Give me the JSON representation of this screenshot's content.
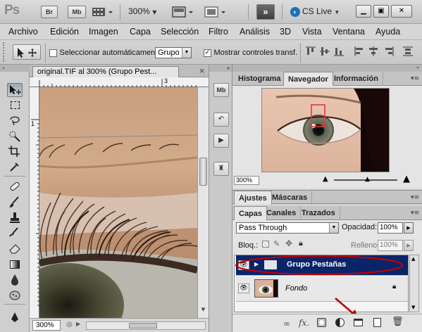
{
  "appbar": {
    "logo": "Ps",
    "btn_br": "Br",
    "btn_mb": "Mb",
    "zoom": "300%",
    "cslive": "CS Live",
    "expand_label": "»"
  },
  "menu": [
    "Archivo",
    "Edición",
    "Imagen",
    "Capa",
    "Selección",
    "Filtro",
    "Análisis",
    "3D",
    "Vista",
    "Ventana",
    "Ayuda"
  ],
  "options": {
    "auto_select_label": "Seleccionar automáticamente:",
    "auto_select_value": "Grupo",
    "show_transform_label": "Mostrar controles transf."
  },
  "document": {
    "tab_title": "original.TIF al 300% (Grupo Pest...",
    "close": "×",
    "ruler_top_tick": "3",
    "ruler_left_tick": "1",
    "zoom_status": "300%"
  },
  "navigator": {
    "tabs": [
      "Histograma",
      "Navegador",
      "Información"
    ],
    "active_tab": "Navegador",
    "zoom": "300%"
  },
  "adjust": {
    "tabs": [
      "Ajustes",
      "Máscaras"
    ]
  },
  "layers_panel": {
    "tabs": [
      "Capas",
      "Canales",
      "Trazados"
    ],
    "blend_mode": "Pass Through",
    "opacity_label": "Opacidad:",
    "opacity_value": "100%",
    "lock_label": "Bloq.:",
    "fill_label": "Relleno:",
    "fill_value": "100%",
    "layers": [
      {
        "name": "Grupo Pestañas",
        "type": "group",
        "selected": true
      },
      {
        "name": "Fondo",
        "type": "background",
        "selected": false
      }
    ]
  },
  "colors": {
    "selection": "#0a246a",
    "highlight_ring": "#c00000",
    "arrow": "#c00000"
  }
}
